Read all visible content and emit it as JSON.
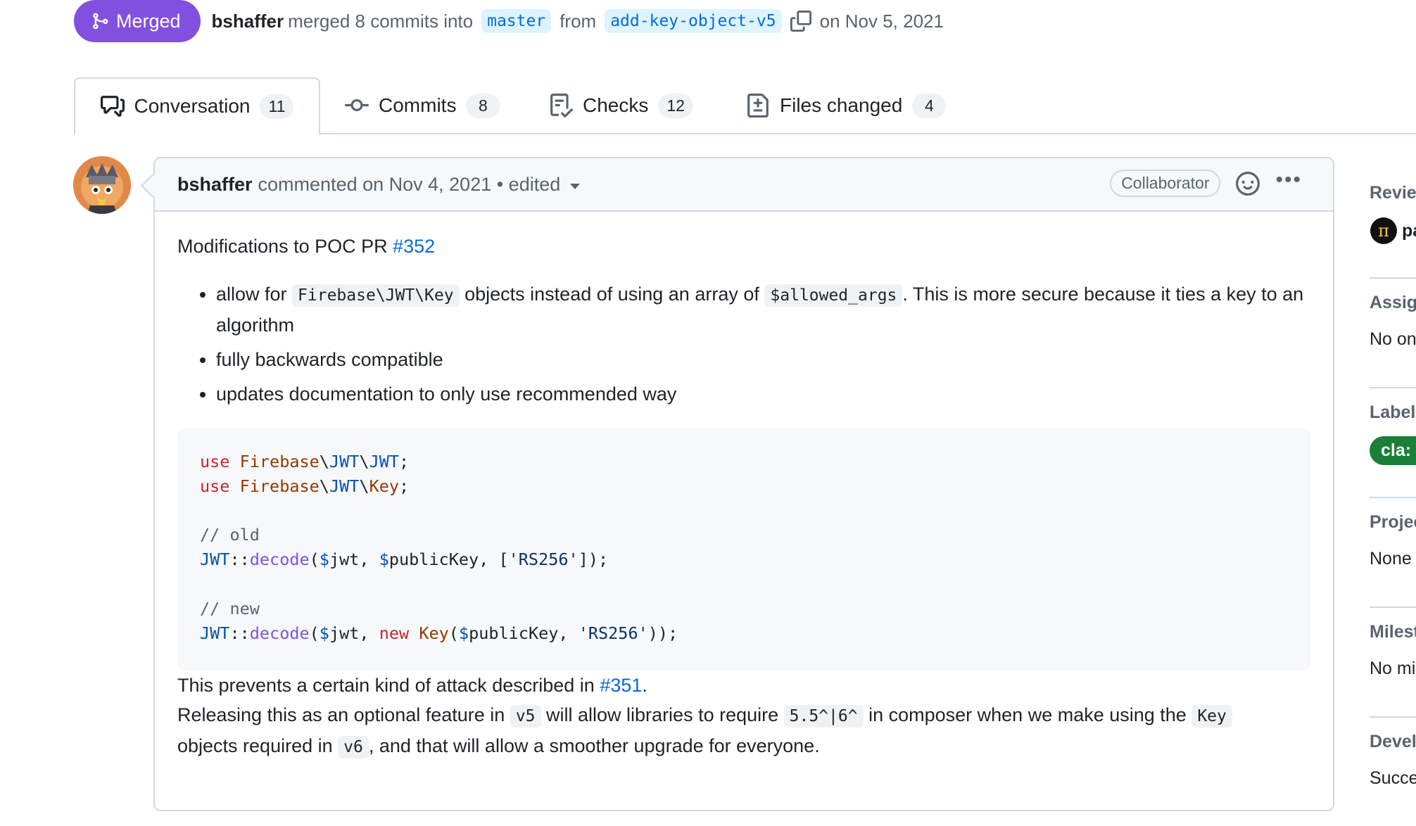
{
  "header": {
    "status": "Merged",
    "author": "bshaffer",
    "merged_text": "merged 8 commits into",
    "base_branch": "master",
    "from_text": "from",
    "head_branch": "add-key-object-v5",
    "date_text": "on Nov 5, 2021"
  },
  "tabs": [
    {
      "label": "Conversation",
      "count": "11",
      "icon": "comment-discussion-icon"
    },
    {
      "label": "Commits",
      "count": "8",
      "icon": "git-commit-icon"
    },
    {
      "label": "Checks",
      "count": "12",
      "icon": "checklist-icon"
    },
    {
      "label": "Files changed",
      "count": "4",
      "icon": "file-diff-icon"
    }
  ],
  "comment": {
    "author": "bshaffer",
    "meta": "commented on Nov 4, 2021 • edited",
    "role": "Collaborator",
    "intro_text": "Modifications to POC PR ",
    "intro_link": "#352",
    "bullet1_a": "allow for ",
    "bullet1_code1": "Firebase\\JWT\\Key",
    "bullet1_b": " objects instead of using an array of ",
    "bullet1_code2": "$allowed_args",
    "bullet1_c": ". This is more secure because it ties a key to an algorithm",
    "bullet2": "fully backwards compatible",
    "bullet3": "updates documentation to only use recommended way",
    "after1_text": "This prevents a certain kind of attack described in ",
    "after1_link": "#351",
    "after1_end": ".",
    "after2_a": "Releasing this as an optional feature in ",
    "after2_code1": "v5",
    "after2_b": " will allow libraries to require ",
    "after2_code2": "5.5^|6^",
    "after2_c": " in composer when we make using the ",
    "after2_code3": "Key",
    "after2_d": " objects required in ",
    "after2_code4": "v6",
    "after2_e": ", and that will allow a smoother upgrade for everyone."
  },
  "sidebar": [
    {
      "title": "Review",
      "value": "pa"
    },
    {
      "title": "Assign",
      "value": "No on"
    },
    {
      "title": "Labels",
      "value": "cla: y"
    },
    {
      "title": "Projec",
      "value": "None"
    },
    {
      "title": "Milest",
      "value": "No mi"
    },
    {
      "title": "Devel",
      "value": "Succe"
    }
  ],
  "colors": {
    "merged": "#8250df",
    "link": "#0969da",
    "label_green": "#1a7f37",
    "border": "#d1d9e0"
  }
}
